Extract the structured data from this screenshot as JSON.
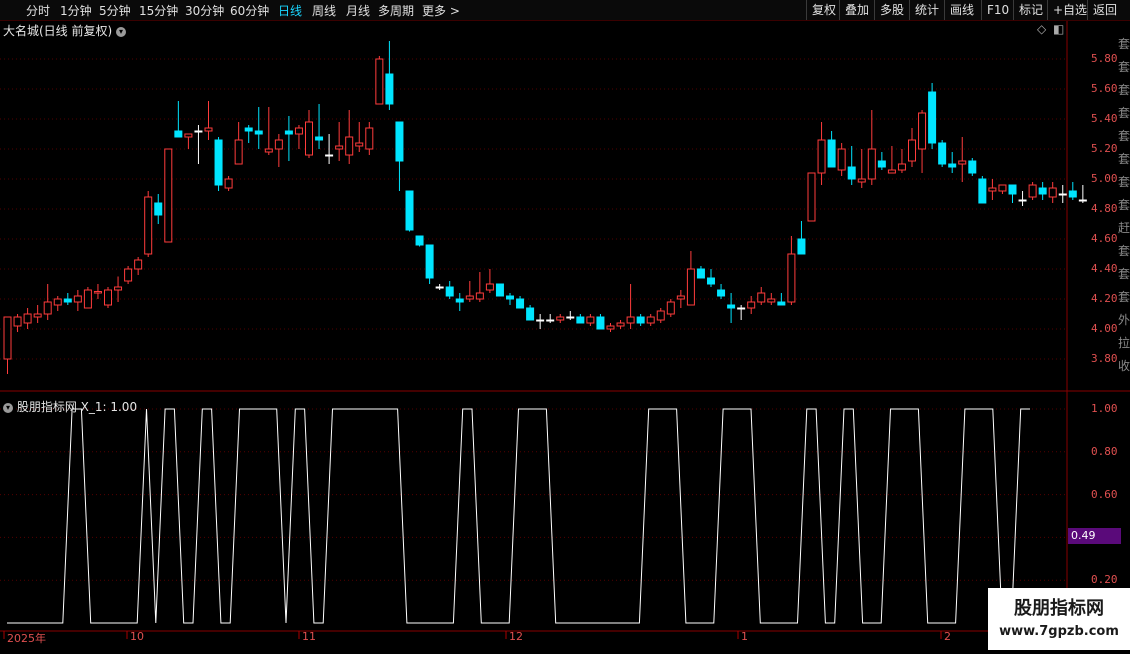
{
  "toolbar": {
    "periods": [
      "分时",
      "1分钟",
      "5分钟",
      "15分钟",
      "30分钟",
      "60分钟",
      "日线",
      "周线",
      "月线",
      "多周期",
      "更多 >"
    ],
    "active": "日线",
    "right": [
      "复权",
      "叠加",
      "多股",
      "统计",
      "画线",
      "F10",
      "标记",
      "+自选",
      "返回"
    ]
  },
  "main_chart": {
    "title": "大名城(日线 前复权)",
    "icons": [
      "chevron-down-icon",
      "diamond-icon",
      "window-icon"
    ],
    "y_ticks": [
      "5.80",
      "5.60",
      "5.40",
      "5.20",
      "5.00",
      "4.80",
      "4.60",
      "4.40",
      "4.20",
      "4.00",
      "3.80"
    ]
  },
  "indicator": {
    "title": "股朋指标网 X_1: 1.00",
    "y_ticks": [
      "1.00",
      "0.80",
      "0.60",
      "0.40",
      "0.20"
    ],
    "current_value": "0.49"
  },
  "dates": [
    "2025年",
    "10",
    "11",
    "12",
    "1",
    "2"
  ],
  "sidebar_chars": [
    "套",
    "套",
    "套",
    "套",
    "套",
    "套",
    "套",
    "套",
    "赶",
    "套",
    "套",
    "套",
    "外",
    "拉",
    "收"
  ],
  "watermark": {
    "line1": "股朋指标网",
    "line2": "www.7gpzb.com"
  },
  "colors": {
    "up": "#ff3c3c",
    "down": "#00e5ff",
    "neutral": "#ffffff",
    "grid": "#550000"
  },
  "chart_data": {
    "type": "candlestick",
    "price_range": [
      3.68,
      5.96
    ],
    "candles": [
      [
        3.8,
        4.08,
        3.7,
        4.08
      ],
      [
        4.02,
        4.1,
        3.98,
        4.08
      ],
      [
        4.04,
        4.14,
        4.0,
        4.1
      ],
      [
        4.08,
        4.16,
        4.04,
        4.1
      ],
      [
        4.1,
        4.3,
        4.06,
        4.18
      ],
      [
        4.16,
        4.22,
        4.12,
        4.2
      ],
      [
        4.2,
        4.24,
        4.16,
        4.18
      ],
      [
        4.18,
        4.26,
        4.12,
        4.22
      ],
      [
        4.14,
        4.28,
        4.14,
        4.26
      ],
      [
        4.24,
        4.3,
        4.2,
        4.25
      ],
      [
        4.16,
        4.28,
        4.14,
        4.26
      ],
      [
        4.26,
        4.35,
        4.18,
        4.28
      ],
      [
        4.32,
        4.42,
        4.3,
        4.4
      ],
      [
        4.4,
        4.48,
        4.36,
        4.46
      ],
      [
        4.5,
        4.92,
        4.48,
        4.88
      ],
      [
        4.84,
        4.9,
        4.7,
        4.76
      ],
      [
        4.58,
        5.2,
        4.58,
        5.2
      ],
      [
        5.32,
        5.52,
        5.28,
        5.28
      ],
      [
        5.28,
        5.3,
        5.2,
        5.3
      ],
      [
        5.32,
        5.36,
        5.1,
        5.32
      ],
      [
        5.32,
        5.52,
        5.26,
        5.34
      ],
      [
        5.26,
        5.28,
        4.92,
        4.96
      ],
      [
        4.94,
        5.02,
        4.92,
        5.0
      ],
      [
        5.1,
        5.38,
        5.1,
        5.26
      ],
      [
        5.34,
        5.36,
        5.24,
        5.32
      ],
      [
        5.32,
        5.48,
        5.2,
        5.3
      ],
      [
        5.18,
        5.48,
        5.16,
        5.2
      ],
      [
        5.2,
        5.3,
        5.08,
        5.26
      ],
      [
        5.32,
        5.42,
        5.12,
        5.3
      ],
      [
        5.3,
        5.36,
        5.2,
        5.34
      ],
      [
        5.16,
        5.46,
        5.14,
        5.38
      ],
      [
        5.28,
        5.5,
        5.2,
        5.26
      ],
      [
        5.16,
        5.3,
        5.1,
        5.16
      ],
      [
        5.2,
        5.38,
        5.12,
        5.22
      ],
      [
        5.16,
        5.46,
        5.1,
        5.28
      ],
      [
        5.22,
        5.38,
        5.18,
        5.24
      ],
      [
        5.2,
        5.38,
        5.16,
        5.34
      ],
      [
        5.5,
        5.82,
        5.5,
        5.8
      ],
      [
        5.7,
        5.92,
        5.46,
        5.5
      ],
      [
        5.38,
        5.38,
        4.92,
        5.12
      ],
      [
        4.92,
        4.92,
        4.65,
        4.66
      ],
      [
        4.62,
        4.62,
        4.55,
        4.56
      ],
      [
        4.56,
        4.56,
        4.3,
        4.34
      ],
      [
        4.28,
        4.3,
        4.26,
        4.28
      ],
      [
        4.28,
        4.32,
        4.2,
        4.22
      ],
      [
        4.2,
        4.24,
        4.12,
        4.18
      ],
      [
        4.2,
        4.32,
        4.18,
        4.22
      ],
      [
        4.2,
        4.38,
        4.18,
        4.24
      ],
      [
        4.26,
        4.4,
        4.24,
        4.3
      ],
      [
        4.3,
        4.3,
        4.22,
        4.22
      ],
      [
        4.22,
        4.24,
        4.16,
        4.2
      ],
      [
        4.2,
        4.22,
        4.14,
        4.14
      ],
      [
        4.14,
        4.16,
        4.06,
        4.06
      ],
      [
        4.06,
        4.1,
        4.0,
        4.06
      ],
      [
        4.06,
        4.1,
        4.04,
        4.06
      ],
      [
        4.06,
        4.1,
        4.04,
        4.08
      ],
      [
        4.08,
        4.12,
        4.06,
        4.08
      ],
      [
        4.08,
        4.1,
        4.04,
        4.04
      ],
      [
        4.04,
        4.1,
        4.02,
        4.08
      ],
      [
        4.08,
        4.1,
        4.0,
        4.0
      ],
      [
        4.0,
        4.04,
        3.98,
        4.02
      ],
      [
        4.02,
        4.06,
        4.0,
        4.04
      ],
      [
        4.04,
        4.3,
        4.0,
        4.08
      ],
      [
        4.08,
        4.1,
        4.02,
        4.04
      ],
      [
        4.04,
        4.1,
        4.02,
        4.08
      ],
      [
        4.06,
        4.14,
        4.04,
        4.12
      ],
      [
        4.1,
        4.2,
        4.08,
        4.18
      ],
      [
        4.2,
        4.26,
        4.14,
        4.22
      ],
      [
        4.16,
        4.52,
        4.16,
        4.4
      ],
      [
        4.4,
        4.42,
        4.34,
        4.34
      ],
      [
        4.34,
        4.4,
        4.28,
        4.3
      ],
      [
        4.26,
        4.3,
        4.2,
        4.22
      ],
      [
        4.16,
        4.24,
        4.04,
        4.14
      ],
      [
        4.14,
        4.16,
        4.06,
        4.14
      ],
      [
        4.14,
        4.22,
        4.1,
        4.18
      ],
      [
        4.18,
        4.28,
        4.16,
        4.24
      ],
      [
        4.18,
        4.24,
        4.16,
        4.2
      ],
      [
        4.18,
        4.24,
        4.16,
        4.16
      ],
      [
        4.18,
        4.62,
        4.16,
        4.5
      ],
      [
        4.6,
        4.72,
        4.5,
        4.5
      ],
      [
        4.72,
        4.92,
        4.72,
        5.04
      ],
      [
        5.04,
        5.38,
        4.96,
        5.26
      ],
      [
        5.26,
        5.32,
        5.1,
        5.08
      ],
      [
        5.06,
        5.24,
        5.02,
        5.2
      ],
      [
        5.08,
        5.22,
        4.96,
        5.0
      ],
      [
        4.98,
        5.2,
        4.94,
        5.0
      ],
      [
        5.0,
        5.46,
        4.96,
        5.2
      ],
      [
        5.12,
        5.18,
        5.06,
        5.08
      ],
      [
        5.04,
        5.22,
        5.04,
        5.06
      ],
      [
        5.06,
        5.2,
        5.04,
        5.1
      ],
      [
        5.12,
        5.34,
        5.08,
        5.26
      ],
      [
        5.2,
        5.46,
        5.04,
        5.44
      ],
      [
        5.58,
        5.64,
        5.2,
        5.24
      ],
      [
        5.24,
        5.26,
        5.08,
        5.1
      ],
      [
        5.1,
        5.18,
        5.04,
        5.08
      ],
      [
        5.1,
        5.28,
        4.98,
        5.12
      ],
      [
        5.12,
        5.14,
        5.02,
        5.04
      ],
      [
        5.0,
        5.02,
        4.84,
        4.84
      ],
      [
        4.92,
        5.0,
        4.86,
        4.94
      ],
      [
        4.92,
        4.96,
        4.9,
        4.96
      ],
      [
        4.96,
        4.96,
        4.84,
        4.9
      ],
      [
        4.86,
        4.92,
        4.82,
        4.86
      ],
      [
        4.88,
        4.98,
        4.86,
        4.96
      ],
      [
        4.94,
        4.98,
        4.86,
        4.9
      ],
      [
        4.88,
        4.98,
        4.84,
        4.94
      ],
      [
        4.9,
        4.96,
        4.84,
        4.9
      ],
      [
        4.92,
        4.98,
        4.86,
        4.88
      ],
      [
        4.86,
        4.96,
        4.84,
        4.86
      ]
    ],
    "indicator_levels": [
      0,
      0,
      0,
      0,
      0,
      0,
      0,
      1,
      1,
      0,
      0,
      0,
      0,
      0,
      0,
      1,
      0,
      1,
      1,
      0,
      0,
      1,
      1,
      0,
      0,
      1,
      1,
      1,
      1,
      1,
      0,
      1,
      1,
      0,
      0,
      1,
      1,
      1,
      1,
      1,
      1,
      1,
      1,
      0,
      0,
      0,
      0,
      0,
      0,
      1,
      1,
      0,
      0,
      0,
      0,
      1,
      1,
      1,
      1,
      0,
      0,
      0,
      0,
      0,
      0,
      0,
      0,
      0,
      0,
      1,
      1,
      1,
      1,
      0,
      0,
      0,
      0,
      1,
      1,
      1,
      1,
      0,
      0,
      0,
      0,
      0,
      1,
      1,
      0,
      0,
      1,
      1,
      0,
      0,
      0,
      1,
      1,
      1,
      1,
      0,
      0,
      0,
      0,
      1,
      1,
      1,
      1,
      0,
      0,
      1,
      1
    ]
  }
}
